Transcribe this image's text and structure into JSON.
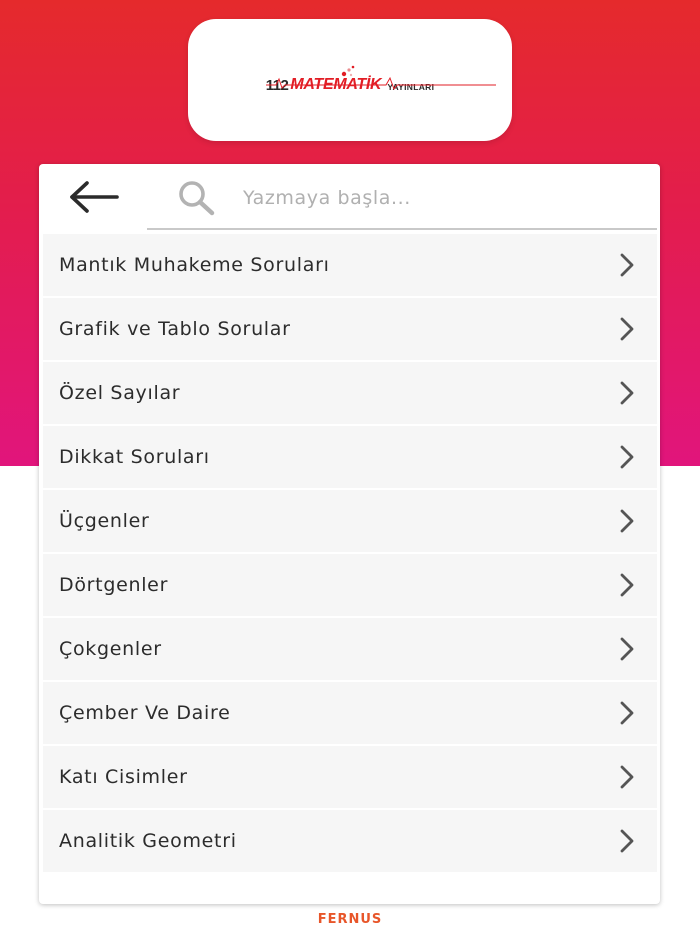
{
  "header": {
    "logo": {
      "number": "112",
      "brand": "MATEMATİK",
      "publisher": "YAYINLARI"
    }
  },
  "search": {
    "placeholder": "Yazmaya başla...",
    "value": ""
  },
  "icons": {
    "back": "arrow-left-icon",
    "search": "search-icon",
    "chevron": "chevron-right-icon"
  },
  "colors": {
    "gradient_top": "#e52a2c",
    "gradient_bottom": "#e1157c",
    "footer_brand": "#e8562a",
    "logo_red": "#e21d25"
  },
  "categories": [
    {
      "label": "Mantık Muhakeme Soruları"
    },
    {
      "label": "Grafik ve Tablo Sorular"
    },
    {
      "label": "Özel Sayılar"
    },
    {
      "label": "Dikkat Soruları"
    },
    {
      "label": "Üçgenler"
    },
    {
      "label": "Dörtgenler"
    },
    {
      "label": "Çokgenler"
    },
    {
      "label": "Çember Ve Daire"
    },
    {
      "label": "Katı Cisimler"
    },
    {
      "label": "Analitik Geometri"
    }
  ],
  "footer": {
    "brand": "FERNUS"
  }
}
